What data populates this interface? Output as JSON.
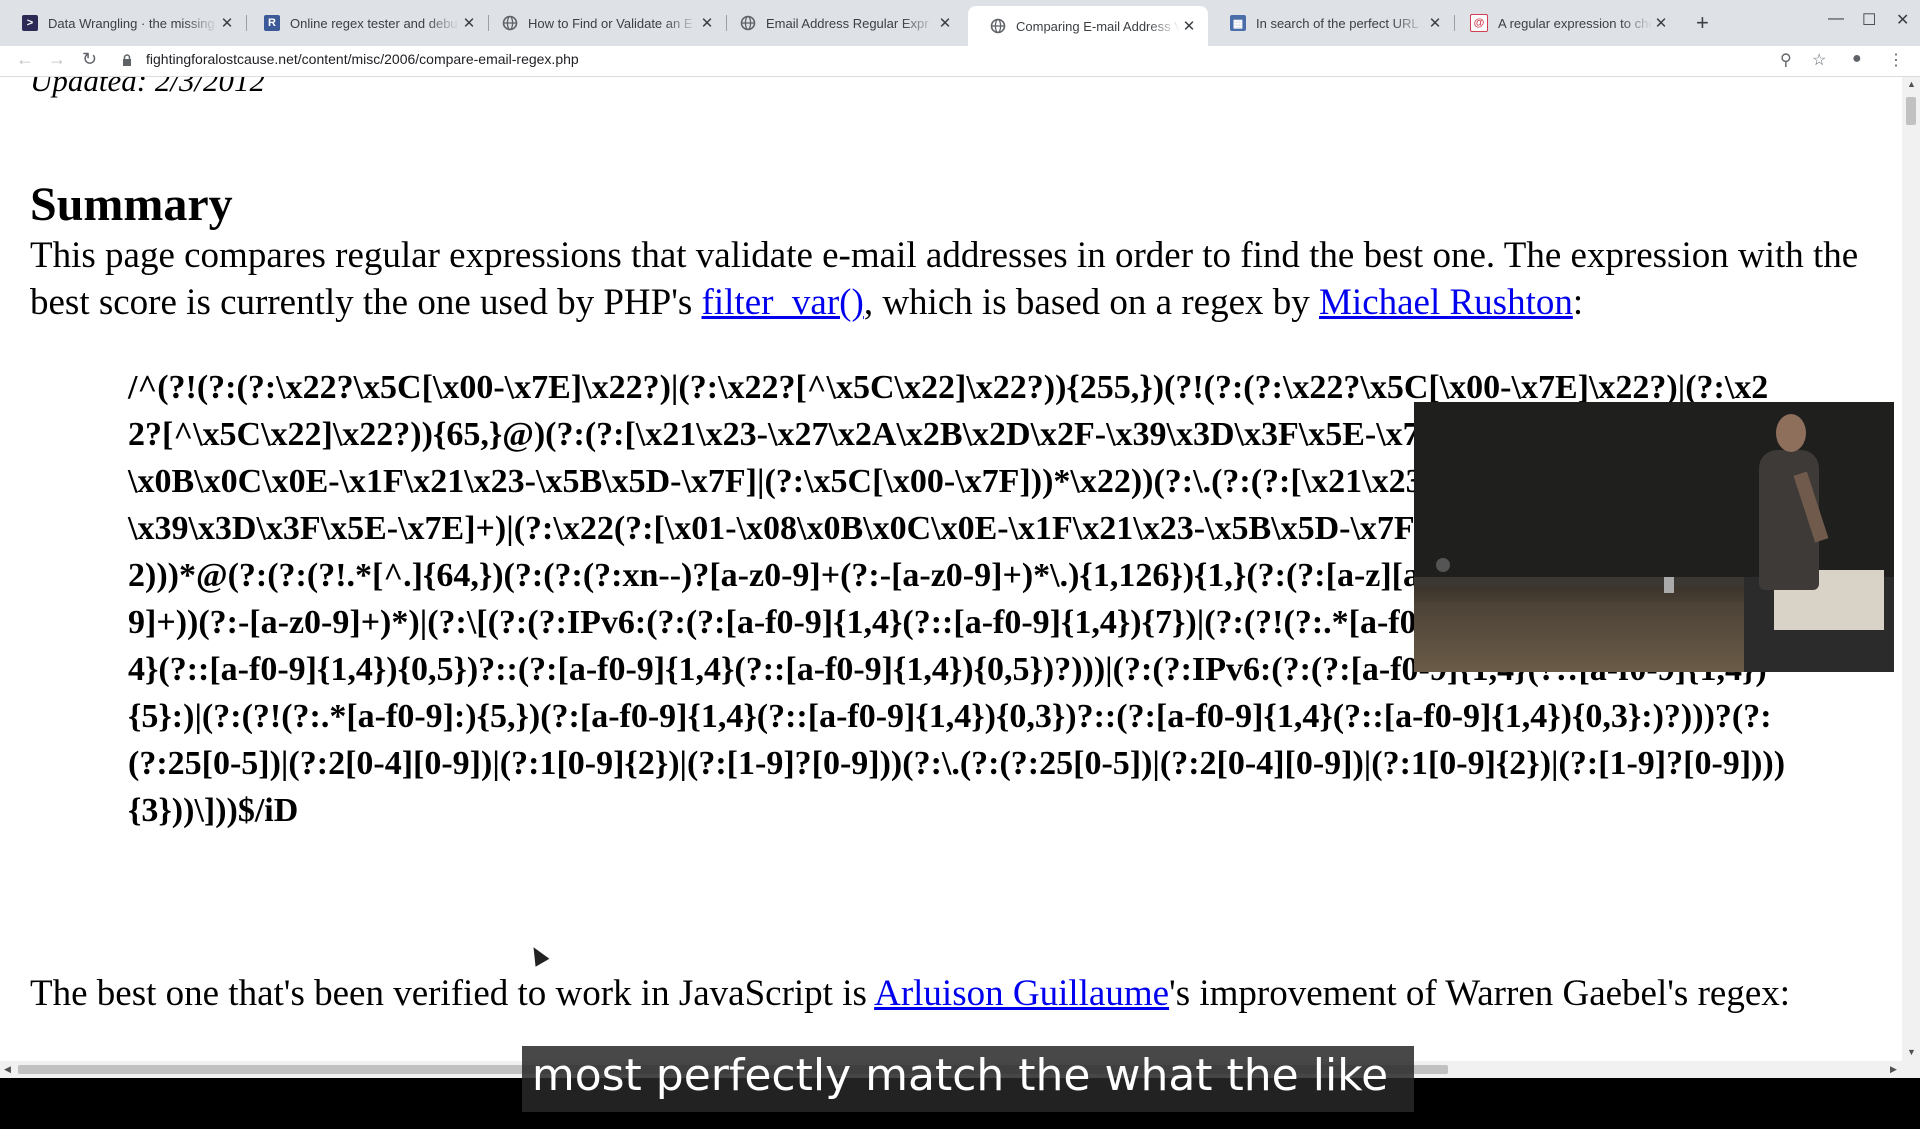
{
  "browser": {
    "tabs": [
      {
        "title": "Data Wrangling · the missing",
        "favicon": "terminal-icon",
        "color": "#2d2b55"
      },
      {
        "title": "Online regex tester and debu",
        "favicon": "regex101-icon",
        "color": "#3d5a98"
      },
      {
        "title": "How to Find or Validate an E",
        "favicon": "globe-icon",
        "color": "#5f6368"
      },
      {
        "title": "Email Address Regular Expr",
        "favicon": "globe-icon",
        "color": "#5f6368"
      },
      {
        "title": "Comparing E-mail Address V",
        "favicon": "globe-icon",
        "color": "#5f6368",
        "active": true
      },
      {
        "title": "In search of the perfect URL",
        "favicon": "image-icon",
        "color": "#4a6ea9"
      },
      {
        "title": "A regular expression to chec",
        "favicon": "at-icon",
        "color": "#d23f54"
      }
    ],
    "url": "fightingforalostcause.net/content/misc/2006/compare-email-regex.php"
  },
  "page": {
    "updated": "Updated: 2/3/2012",
    "summary_title": "Summary",
    "intro_text_1": "This page compares regular expressions that validate e-mail addresses in order to find the best one. The expression with the best score is currently the one used by PHP's ",
    "intro_link_1": "filter_var()",
    "intro_text_2": ", which is based on a regex by ",
    "intro_link_2": "Michael Rushton",
    "intro_text_3": ":",
    "regex": "/^(?!(?:(?:\\x22?\\x5C[\\x00-\\x7E]\\x22?)|(?:\\x22?[^\\x5C\\x22]\\x22?)){255,})(?!(?:(?:\\x22?\\x5C[\\x00-\\x7E]\\x22?)|(?:\\x22?[^\\x5C\\x22]\\x22?)){65,}@)(?:(?:[\\x21\\x23-\\x27\\x2A\\x2B\\x2D\\x2F-\\x39\\x3D\\x3F\\x5E-\\x7E]+)|(?:\\x22(?:[\\x01-\\x08\\x0B\\x0C\\x0E-\\x1F\\x21\\x23-\\x5B\\x5D-\\x7F]|(?:\\x5C[\\x00-\\x7F]))*\\x22))(?:\\.(?:(?:[\\x21\\x23-\\x27\\x2A\\x2B\\x2D\\x2F-\\x39\\x3D\\x3F\\x5E-\\x7E]+)|(?:\\x22(?:[\\x01-\\x08\\x0B\\x0C\\x0E-\\x1F\\x21\\x23-\\x5B\\x5D-\\x7F]|(?:\\x5C[\\x00-\\x7F]))*\\x22)))*@(?:(?:(?!.*[^.]{64,})(?:(?:(?:xn--)?[a-z0-9]+(?:-[a-z0-9]+)*\\.){1,126}){1,}(?:(?:[a-z][a-z0-9]*)|(?:(?:xn--)[a-z0-9]+))(?:-[a-z0-9]+)*)|(?:\\[(?:(?:IPv6:(?:(?:[a-f0-9]{1,4}(?::[a-f0-9]{1,4}){7})|(?:(?!(?:.*[a-f0-9][:\\]]){7,})(?:[a-f0-9]{1,4}(?::[a-f0-9]{1,4}){0,5})?::(?:[a-f0-9]{1,4}(?::[a-f0-9]{1,4}){0,5})?)))|(?:(?:IPv6:(?:(?:[a-f0-9]{1,4}(?::[a-f0-9]{1,4}){5}:)|(?:(?!(?:.*[a-f0-9]:){5,})(?:[a-f0-9]{1,4}(?::[a-f0-9]{1,4}){0,3})?::(?:[a-f0-9]{1,4}(?::[a-f0-9]{1,4}){0,3}:)?)))?(?:(?:25[0-5])|(?:2[0-4][0-9])|(?:1[0-9]{2})|(?:[1-9]?[0-9]))(?:\\.(?:(?:25[0-5])|(?:2[0-4][0-9])|(?:1[0-9]{2})|(?:[1-9]?[0-9]))){3}))\\]))$/iD",
    "best_text_1": "The best one that's been verified to work in JavaScript is ",
    "best_link": "Arluison Guillaume",
    "best_text_2": "'s improvement of Warren Gaebel's regex:"
  },
  "overlay": {
    "subtitle": "most perfectly match the what the like"
  }
}
